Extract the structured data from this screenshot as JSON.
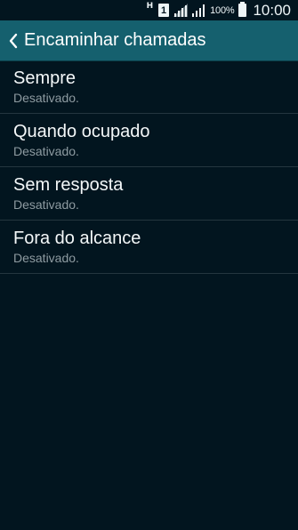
{
  "status_bar": {
    "network_type": "H",
    "sim_slot": "1",
    "battery_percent": "100%",
    "time": "10:00",
    "icons": [
      "network-type-icon",
      "sim-card-icon",
      "signal-strength-icon",
      "signal-strength-icon",
      "battery-icon"
    ]
  },
  "action_bar": {
    "back_icon": "chevron-left-icon",
    "title": "Encaminhar chamadas",
    "background": "#15606e"
  },
  "list": {
    "items": [
      {
        "title": "Sempre",
        "summary": "Desativado."
      },
      {
        "title": "Quando ocupado",
        "summary": "Desativado."
      },
      {
        "title": "Sem resposta",
        "summary": "Desativado."
      },
      {
        "title": "Fora do alcance",
        "summary": "Desativado."
      }
    ]
  },
  "colors": {
    "background": "#02151f",
    "accent": "#15606e",
    "summary_text": "#8e9ba1"
  }
}
